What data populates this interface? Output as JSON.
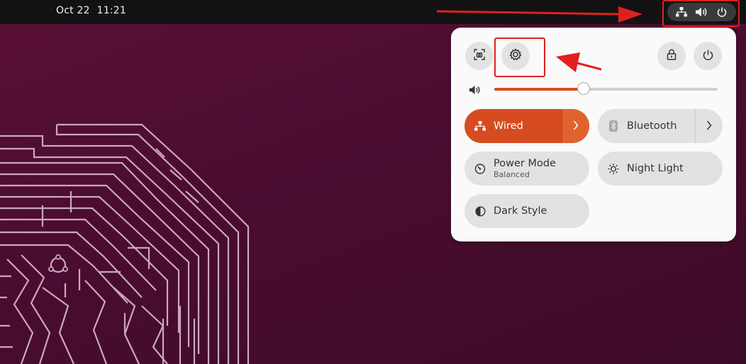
{
  "topbar": {
    "date": "Oct 22",
    "time": "11:21",
    "tray_icons": [
      "network-wired-icon",
      "volume-icon",
      "power-icon"
    ]
  },
  "quick_settings": {
    "header_buttons": [
      "screenshot-icon",
      "settings-icon",
      "lock-icon",
      "power-icon"
    ],
    "volume": {
      "icon": "volume-icon",
      "level": 0.4
    },
    "toggles": {
      "wired": {
        "label": "Wired",
        "active": true
      },
      "bluetooth": {
        "label": "Bluetooth",
        "active": false
      },
      "power_mode": {
        "label": "Power Mode",
        "subtitle": "Balanced",
        "active": false
      },
      "night_light": {
        "label": "Night Light",
        "active": false
      },
      "dark_style": {
        "label": "Dark Style",
        "active": false
      }
    }
  },
  "colors": {
    "accent": "#d64c20",
    "annotation": "#e0201e",
    "topbar": "#121212",
    "desktop": "#4a0c30"
  }
}
